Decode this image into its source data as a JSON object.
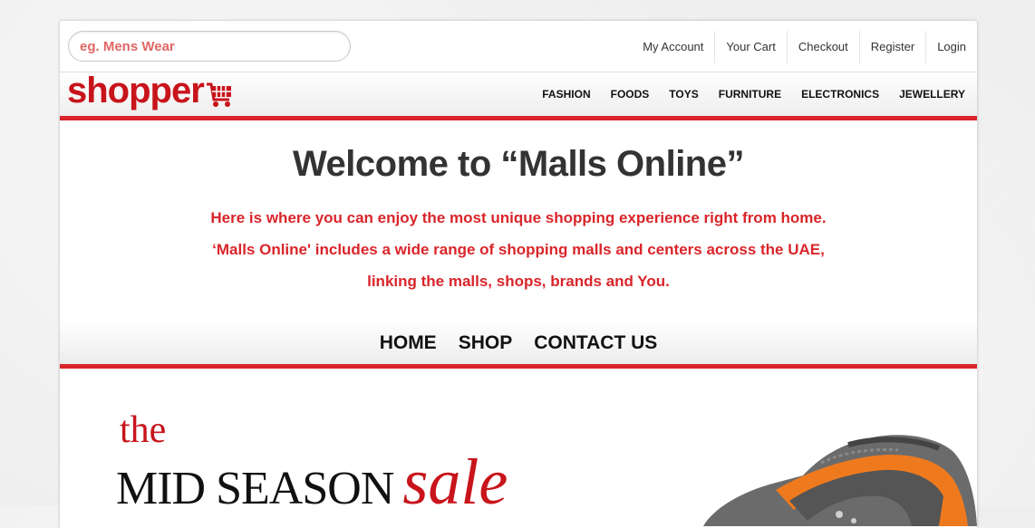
{
  "search": {
    "placeholder": "eg. Mens Wear"
  },
  "top_links": [
    "My Account",
    "Your Cart",
    "Checkout",
    "Register",
    "Login"
  ],
  "logo": {
    "text": "shopper",
    "icon": "shopping-cart-icon"
  },
  "categories": [
    "FASHION",
    "FOODS",
    "TOYS",
    "FURNITURE",
    "ELECTRONICS",
    "JEWELLERY"
  ],
  "welcome": {
    "title": "Welcome to “Malls Online”",
    "lines": [
      "Here is where you can enjoy the most unique shopping experience right from home.",
      "‘Malls Online' includes a wide range of shopping malls and centers across the UAE,",
      "linking the malls, shops, brands and You."
    ]
  },
  "main_nav": [
    "HOME",
    "SHOP",
    "CONTACT US"
  ],
  "promo": {
    "the": "the",
    "mid_season": "MID SEASON",
    "sale": "sale",
    "image": "sandal-image"
  },
  "colors": {
    "accent": "#d9252a",
    "logo": "#c8141b",
    "text": "#333333"
  }
}
